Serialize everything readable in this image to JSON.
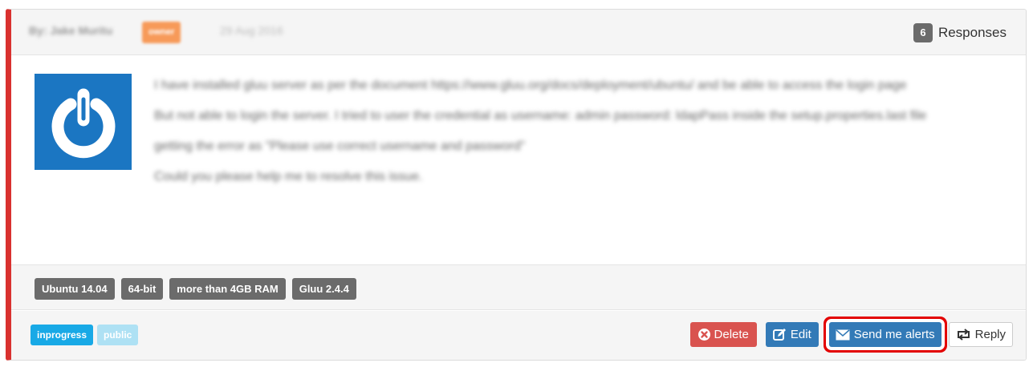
{
  "post": {
    "author": "By: Jake Muritu",
    "owner_badge": "owner",
    "date": "29 Aug 2016",
    "responses_count": "6",
    "responses_label": "Responses",
    "paragraphs": [
      "I have installed gluu server as per the document https://www.gluu.org/docs/deployment/ubuntu/ and be able to access the login page",
      "But not able to login the server. I tried to user the credential as username: admin password: ldapPass inside the setup.properties.last file",
      "getting the error as \"Please use correct username and password\"",
      "Could you please help me to resolve this issue."
    ]
  },
  "tags": [
    "Ubuntu 14.04",
    "64-bit",
    "more than 4GB RAM",
    "Gluu 2.4.4"
  ],
  "statuses": {
    "inprogress": "inprogress",
    "public": "public"
  },
  "actions": {
    "delete_label": "Delete",
    "edit_label": "Edit",
    "alerts_label": "Send me alerts",
    "reply_label": "Reply"
  },
  "icons": {
    "avatar": "power-icon",
    "delete": "close-icon",
    "edit": "edit-icon",
    "alerts": "envelope-icon",
    "reply": "retweet-icon"
  },
  "colors": {
    "accent_border": "#d9312f",
    "danger": "#d9534f",
    "primary": "#337ab7",
    "highlight_box": "#e30000",
    "status_inprogress": "#18a9e6",
    "status_public": "#aee1f4",
    "avatar_bg": "#1b76c2"
  }
}
